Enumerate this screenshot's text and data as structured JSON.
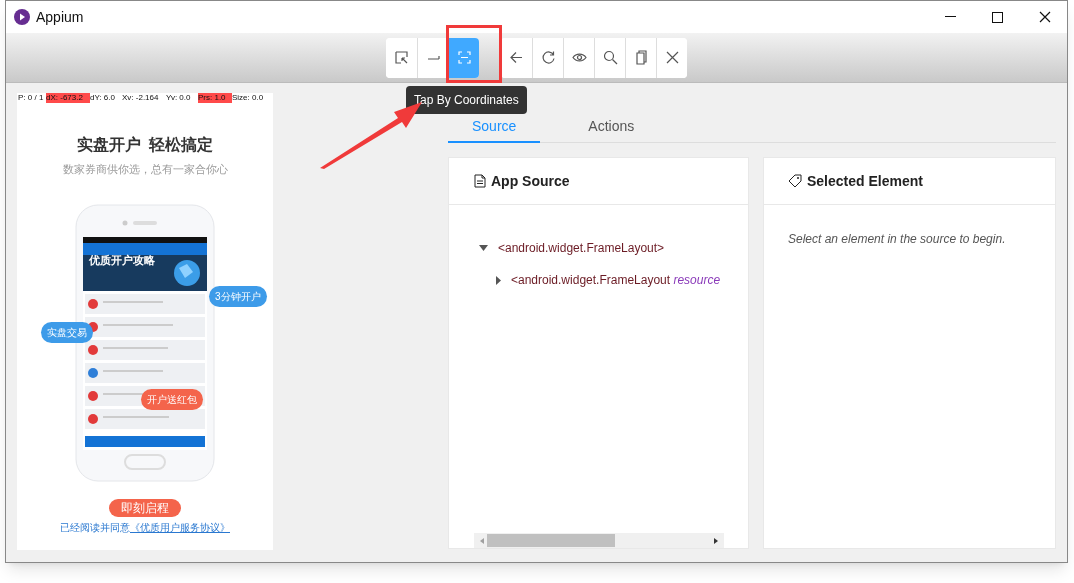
{
  "window": {
    "title": "Appium"
  },
  "toolbar": {
    "groups": [
      [
        {
          "kind": "select",
          "selected": false
        },
        {
          "kind": "swipe",
          "selected": false
        },
        {
          "kind": "tap",
          "selected": true
        }
      ],
      [
        {
          "kind": "back",
          "selected": false
        },
        {
          "kind": "refresh",
          "selected": false
        },
        {
          "kind": "eye",
          "selected": false
        },
        {
          "kind": "search",
          "selected": false
        },
        {
          "kind": "copy",
          "selected": false
        },
        {
          "kind": "close",
          "selected": false
        }
      ]
    ],
    "tooltip": "Tap By Coordinates"
  },
  "device_screen": {
    "debug_bar": [
      {
        "text": "P: 0 / 1",
        "highlighted": false
      },
      {
        "text": "dX: -673.2",
        "highlighted": true
      },
      {
        "text": "dY: 6.0",
        "highlighted": false
      },
      {
        "text": "Xv: -2.164",
        "highlighted": false
      },
      {
        "text": "Yv: 0.0",
        "highlighted": false
      },
      {
        "text": "Prs: 1.0",
        "highlighted": true
      },
      {
        "text": "Size: 0.0",
        "highlighted": false
      }
    ],
    "headline": "实盘开户  轻松搞定",
    "subtitle": "数家券商供你选，总有一家合你心",
    "banner": "优质开户攻略",
    "bubbles": [
      {
        "text": "3分钟开户",
        "color": "#3d9be9"
      },
      {
        "text": "实盘交易",
        "color": "#3d9be9"
      },
      {
        "text": "开户送红包",
        "color": "#f4644b"
      }
    ],
    "button": "即刻启程",
    "agreement": "已经阅读并同意",
    "agreement_link": "《优质用户服务协议》"
  },
  "tabs": [
    {
      "label": "Source",
      "selected": true
    },
    {
      "label": "Actions",
      "selected": false
    }
  ],
  "app_source": {
    "title": "App Source",
    "tree": [
      {
        "text": "<android.widget.FrameLayout>",
        "expanded": true,
        "children": [
          {
            "text": "<android.widget.FrameLayout",
            "attribute": "resource",
            "expanded": false
          }
        ]
      }
    ]
  },
  "selected_element": {
    "title": "Selected Element",
    "hint": "Select an element in the source to begin."
  }
}
